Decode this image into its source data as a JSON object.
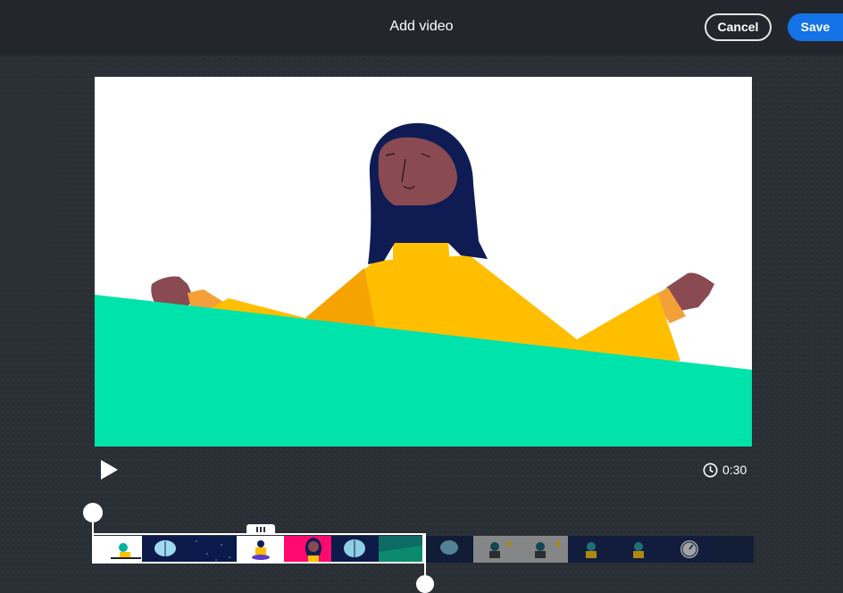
{
  "header": {
    "title": "Add video",
    "cancel_label": "Cancel",
    "save_label": "Save"
  },
  "player": {
    "duration": "0:30",
    "play_icon": "play-icon",
    "clock_icon": "clock-icon"
  },
  "timeline": {
    "frame_count": 14,
    "selection_end_fraction": 0.5
  },
  "colors": {
    "background": "#2a2e35",
    "header": "#23272d",
    "accent": "#1473e6",
    "video_green": "#00e3ab",
    "video_yellow": "#ffbf00",
    "hair": "#0f1c54",
    "skin": "#8a4a52"
  }
}
